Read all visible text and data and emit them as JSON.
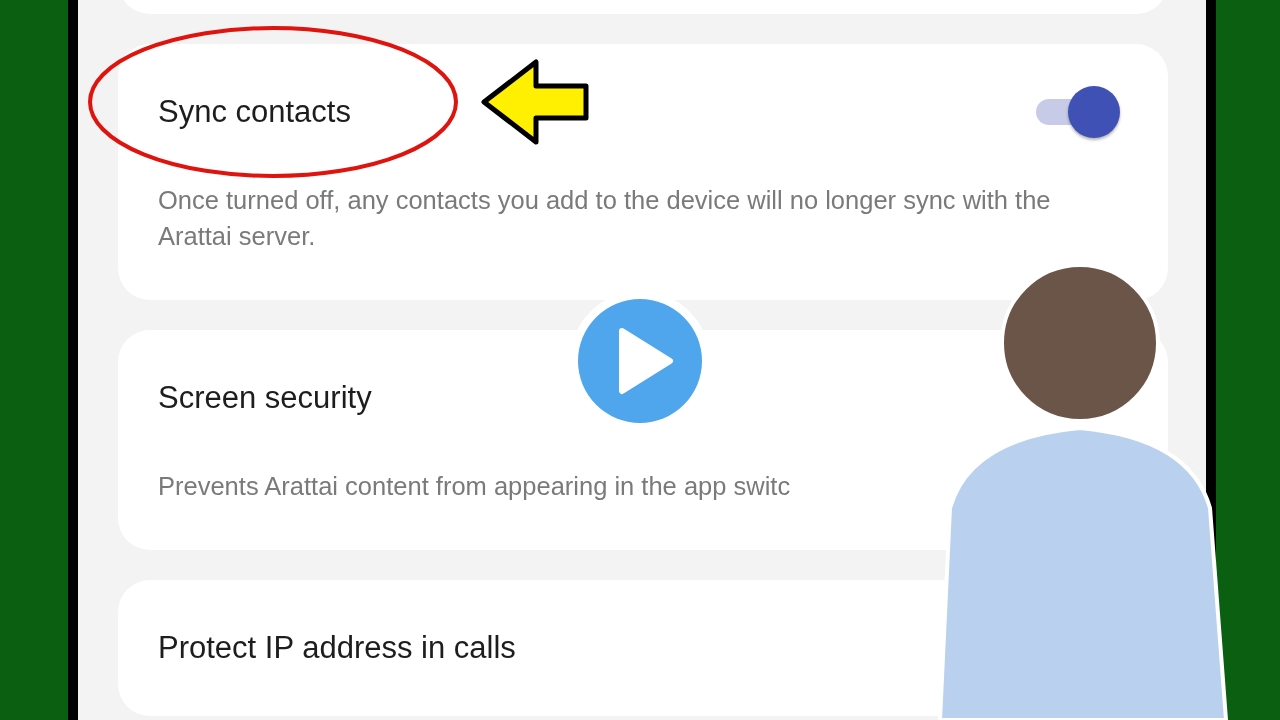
{
  "settings": [
    {
      "kind": "toggle",
      "title": "Sync contacts",
      "description": "Once turned off, any contacts you add to the device will no longer sync with the Arattai server.",
      "on": true
    },
    {
      "kind": "plain",
      "title": "Screen security",
      "description": "Prevents Arattai content from appearing in the app switc"
    },
    {
      "kind": "plain",
      "title": "Protect IP address in calls"
    }
  ]
}
